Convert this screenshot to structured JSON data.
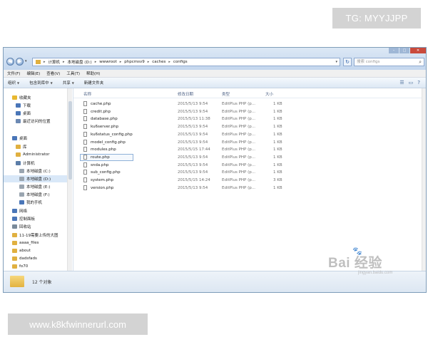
{
  "overlay": {
    "tg_badge": "TG: MYYJJPP",
    "url_badge": "www.k8kfwinnerurl.com"
  },
  "window": {
    "address": {
      "segments": [
        "计算机",
        "本地磁盘 (D:)",
        "wwwroot",
        "phpcmsv9",
        "caches",
        "configs"
      ]
    },
    "search": {
      "placeholder": "搜索 configs"
    },
    "menu": [
      "文件(F)",
      "编辑(E)",
      "查看(V)",
      "工具(T)",
      "帮助(H)"
    ],
    "toolbar": [
      "组织",
      "包含到库中",
      "共享",
      "新建文件夹"
    ],
    "nav": [
      {
        "label": "收藏夹",
        "icon": "star-icon",
        "color": "#e8b830"
      },
      {
        "label": "下载",
        "icon": "download-folder-icon",
        "color": "#4a76b8"
      },
      {
        "label": "桌面",
        "icon": "desktop-icon",
        "color": "#4a76b8"
      },
      {
        "label": "最近访问的位置",
        "icon": "recent-places-icon",
        "color": "#6c89b3"
      },
      {
        "label": "桌面",
        "icon": "desktop-icon",
        "color": "#4a76b8"
      },
      {
        "label": "库",
        "icon": "library-icon",
        "color": "#e0b040"
      },
      {
        "label": "Administrator",
        "icon": "user-folder-icon",
        "color": "#e0b040"
      },
      {
        "label": "计算机",
        "icon": "computer-icon",
        "color": "#5b7da8"
      },
      {
        "label": "本地磁盘 (C:)",
        "icon": "drive-icon",
        "color": "#9aa5b0"
      },
      {
        "label": "本地磁盘 (D:)",
        "icon": "drive-icon",
        "color": "#9aa5b0",
        "selected": true
      },
      {
        "label": "本地磁盘 (E:)",
        "icon": "drive-icon",
        "color": "#9aa5b0"
      },
      {
        "label": "本地磁盘 (F:)",
        "icon": "drive-icon",
        "color": "#9aa5b0"
      },
      {
        "label": "我的手机",
        "icon": "phone-icon",
        "color": "#4a76b8"
      },
      {
        "label": "网络",
        "icon": "network-icon",
        "color": "#4a76b8"
      },
      {
        "label": "控制面板",
        "icon": "control-panel-icon",
        "color": "#4a76b8"
      },
      {
        "label": "回收站",
        "icon": "recycle-bin-icon",
        "color": "#7a8a9a"
      },
      {
        "label": "11-19需要上传的大图",
        "icon": "folder-icon",
        "color": "#e0b040"
      },
      {
        "label": "aaaa_files",
        "icon": "folder-icon",
        "color": "#e0b040"
      },
      {
        "label": "about",
        "icon": "folder-icon",
        "color": "#e0b040"
      },
      {
        "label": "dadsfads",
        "icon": "folder-icon",
        "color": "#e0b040"
      },
      {
        "label": "fo70",
        "icon": "folder-icon",
        "color": "#e0b040"
      }
    ],
    "columns": {
      "name": "名称",
      "date": "修改日期",
      "type": "类型",
      "size": "大小"
    },
    "files": [
      {
        "name": "cache.php",
        "date": "2015/5/13 9:54",
        "type": "EditPlus PHP (p...",
        "size": "1 KB"
      },
      {
        "name": "credit.php",
        "date": "2015/5/13 9:54",
        "type": "EditPlus PHP (p...",
        "size": "1 KB"
      },
      {
        "name": "database.php",
        "date": "2015/5/13 11:38",
        "type": "EditPlus PHP (p...",
        "size": "1 KB"
      },
      {
        "name": "ku6server.php",
        "date": "2015/5/13 9:54",
        "type": "EditPlus PHP (p...",
        "size": "1 KB"
      },
      {
        "name": "ku6status_config.php",
        "date": "2015/5/13 9:54",
        "type": "EditPlus PHP (p...",
        "size": "1 KB"
      },
      {
        "name": "model_config.php",
        "date": "2015/5/13 9:54",
        "type": "EditPlus PHP (p...",
        "size": "1 KB"
      },
      {
        "name": "modules.php",
        "date": "2015/5/15 17:44",
        "type": "EditPlus PHP (p...",
        "size": "1 KB"
      },
      {
        "name": "route.php",
        "date": "2015/5/13 9:54",
        "type": "EditPlus PHP (p...",
        "size": "1 KB",
        "selected": true
      },
      {
        "name": "snda.php",
        "date": "2015/5/13 9:54",
        "type": "EditPlus PHP (p...",
        "size": "1 KB"
      },
      {
        "name": "sub_config.php",
        "date": "2015/5/13 9:54",
        "type": "EditPlus PHP (p...",
        "size": "1 KB"
      },
      {
        "name": "system.php",
        "date": "2015/5/15 14:24",
        "type": "EditPlus PHP (p...",
        "size": "3 KB"
      },
      {
        "name": "version.php",
        "date": "2015/5/13 9:54",
        "type": "EditPlus PHP (p...",
        "size": "1 KB"
      }
    ],
    "status": "12 个对象"
  },
  "watermark": {
    "main": "Bai 经验",
    "sub": "jingyan.baidu.com"
  }
}
